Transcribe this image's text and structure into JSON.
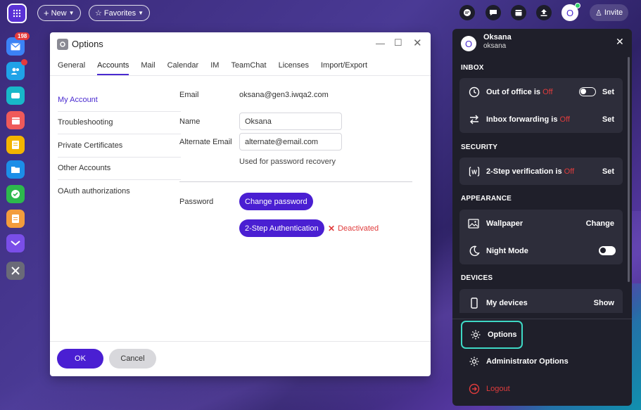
{
  "topbar": {
    "new_label": "New",
    "favorites_label": "Favorites",
    "invite_label": "Invite",
    "avatar_initial": "O"
  },
  "dock": {
    "mail_badge": "198"
  },
  "dialog": {
    "title": "Options",
    "tabs": [
      "General",
      "Accounts",
      "Mail",
      "Calendar",
      "IM",
      "TeamChat",
      "Licenses",
      "Import/Export"
    ],
    "active_tab": "Accounts",
    "sidenav": [
      "My Account",
      "Troubleshooting",
      "Private Certificates",
      "Other Accounts",
      "OAuth authorizations"
    ],
    "email_label": "Email",
    "email_value": "oksana@gen3.iwqa2.com",
    "name_label": "Name",
    "name_value": "Oksana",
    "alt_email_label": "Alternate Email",
    "alt_email_value": "alternate@email.com",
    "alt_email_hint": "Used for password recovery",
    "password_label": "Password",
    "change_password": "Change password",
    "two_step_button": "2-Step Authentication",
    "two_step_status": "Deactivated",
    "ok": "OK",
    "cancel": "Cancel"
  },
  "panel": {
    "avatar_initial": "O",
    "name": "Oksana",
    "username": "oksana",
    "inbox_header": "INBOX",
    "ooo_label": "Out of office is",
    "ooo_state": "Off",
    "ooo_action": "Set",
    "fwd_label": "Inbox forwarding is",
    "fwd_state": "Off",
    "fwd_action": "Set",
    "security_header": "SECURITY",
    "twostep_label": "2-Step verification is",
    "twostep_state": "Off",
    "twostep_action": "Set",
    "appearance_header": "APPEARANCE",
    "wallpaper_label": "Wallpaper",
    "wallpaper_action": "Change",
    "night_label": "Night Mode",
    "devices_header": "DEVICES",
    "devices_label": "My devices",
    "devices_action": "Show",
    "options_label": "Options",
    "admin_label": "Administrator Options",
    "logout_label": "Logout"
  },
  "colors": {
    "accent": "#4a1fd2",
    "off_red": "#e03c3c",
    "highlight": "#3ed8c4"
  }
}
